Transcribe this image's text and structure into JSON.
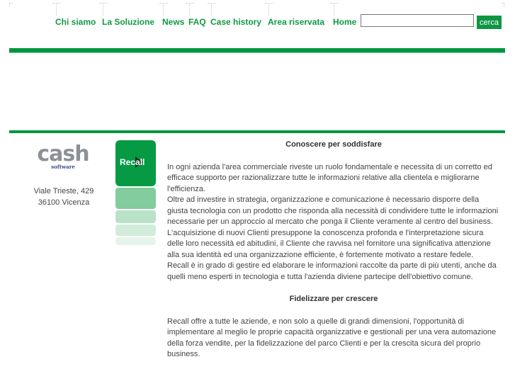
{
  "nav": {
    "items": [
      {
        "label": "Chi siamo"
      },
      {
        "label": "La Soluzione"
      },
      {
        "label": "News"
      },
      {
        "label": "FAQ"
      },
      {
        "label": "Case history"
      },
      {
        "label": "Area riservata"
      },
      {
        "label": "Home"
      }
    ]
  },
  "search": {
    "value": "",
    "placeholder": "",
    "button_label": "cerca"
  },
  "colors": {
    "brand_green": "#00953f",
    "text_gray": "#444444"
  },
  "sidebar": {
    "logo_main": "cash",
    "logo_sub": "software",
    "address_line1": "Viale Trieste, 429",
    "address_line2": "36100 Vicenza",
    "product_logo": "Recall"
  },
  "article": {
    "heading1": "Conoscere per soddisfare",
    "paragraphs1": [
      "In ogni azienda l'area commerciale riveste un ruolo fondamentale e necessita di un corretto ed efficace supporto per razionalizzare tutte le informazioni relative alla clientela e migliorarne l'efficienza.",
      "Oltre ad investire in strategia, organizzazione e comunicazione è necessario disporre della giusta tecnologia con un prodotto che risponda alla necessità di condividere tutte le informazioni necessarie per un approccio al mercato che ponga il Cliente veramente al centro del business.",
      "L'acquisizione di nuovi Clienti presuppone la conoscenza profonda e l'interpretazione sicura delle loro necessità ed abitudini, il Cliente che ravvisa nel fornitore una significativa attenzione alla sua identità ed una organizzazione efficiente, è fortemente motivato a restare fedele.",
      "Recall è in grado di gestire ed elaborare le informazioni raccolte da parte di più utenti, anche da quelli meno esperti in tecnologia e tutta l'azienda diviene partecipe dell'obiettivo comune."
    ],
    "heading2": "Fidelizzare per crescere",
    "paragraphs2": [
      "Recall offre a tutte le aziende, e non solo a quelle di grandi dimensioni, l'opportunità di implementare al meglio le proprie capacità organizzative e gestionali per una vera automazione della forza vendite, per la fidelizzazione del parco Clienti e per la crescita sicura del proprio business."
    ]
  }
}
